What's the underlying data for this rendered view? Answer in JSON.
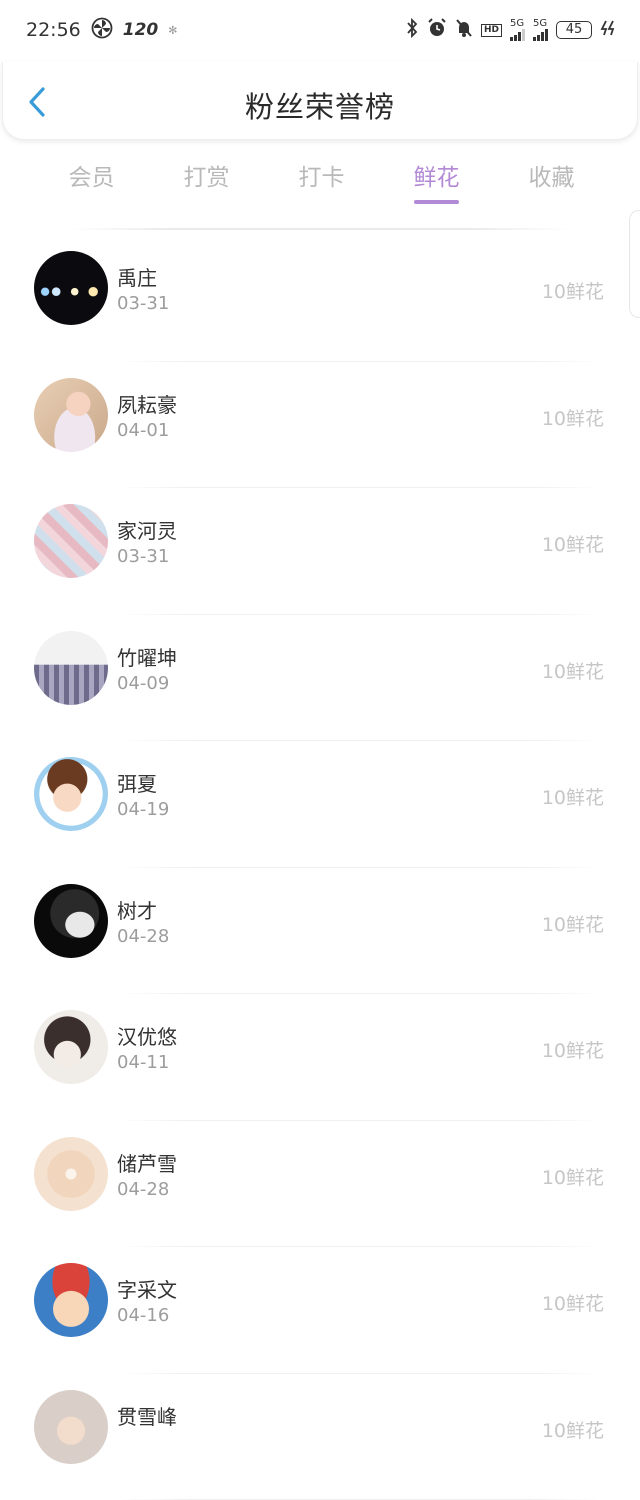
{
  "status_bar": {
    "time": "22:56",
    "refresh_rate": "120",
    "hd_label": "HD",
    "net1": "5G",
    "net2": "5G",
    "battery": "45"
  },
  "header": {
    "title": "粉丝荣誉榜"
  },
  "tabs": [
    {
      "label": "会员"
    },
    {
      "label": "打赏"
    },
    {
      "label": "打卡"
    },
    {
      "label": "鲜花"
    },
    {
      "label": "收藏"
    }
  ],
  "active_tab_index": 3,
  "colors": {
    "accent": "#b38ad6",
    "back_arrow": "#3a9bd9"
  },
  "fans": [
    {
      "name": "禹庄",
      "date": "03-31",
      "amount": "10鲜花"
    },
    {
      "name": "夙耘豪",
      "date": "04-01",
      "amount": "10鲜花"
    },
    {
      "name": "家河灵",
      "date": "03-31",
      "amount": "10鲜花"
    },
    {
      "name": "竹曜坤",
      "date": "04-09",
      "amount": "10鲜花"
    },
    {
      "name": "弭夏",
      "date": "04-19",
      "amount": "10鲜花"
    },
    {
      "name": "树才",
      "date": "04-28",
      "amount": "10鲜花"
    },
    {
      "name": "汉优悠",
      "date": "04-11",
      "amount": "10鲜花"
    },
    {
      "name": "储芦雪",
      "date": "04-28",
      "amount": "10鲜花"
    },
    {
      "name": "字采文",
      "date": "04-16",
      "amount": "10鲜花"
    },
    {
      "name": "贯雪峰",
      "date": "",
      "amount": "10鲜花"
    }
  ]
}
